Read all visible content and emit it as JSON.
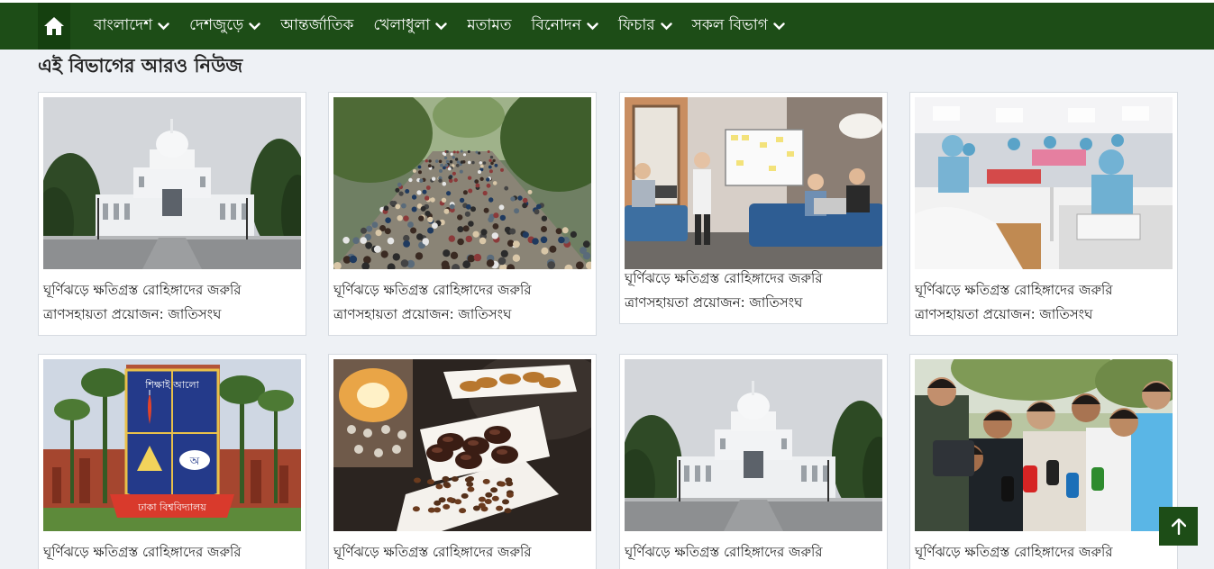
{
  "nav": {
    "items": [
      {
        "label": "বাংলাদেশ",
        "has_dropdown": true
      },
      {
        "label": "দেশজুড়ে",
        "has_dropdown": true
      },
      {
        "label": "আন্তর্জাতিক",
        "has_dropdown": false
      },
      {
        "label": "খেলাধুলা",
        "has_dropdown": true
      },
      {
        "label": "মতামত",
        "has_dropdown": false
      },
      {
        "label": "বিনোদন",
        "has_dropdown": true
      },
      {
        "label": "ফিচার",
        "has_dropdown": true
      },
      {
        "label": "সকল বিভাগ",
        "has_dropdown": true
      }
    ],
    "home_icon": "home-icon"
  },
  "section": {
    "title": "এই বিভাগের আরও নিউজ"
  },
  "cards": [
    {
      "image": "high-court-building",
      "headline": "ঘূর্ণিঝড়ে ক্ষতিগ্রস্ত রোহিঙ্গাদের জরুরি ত্রাণসহায়তা প্রয়োজন: জাতিসংঘ"
    },
    {
      "image": "street-crowd",
      "headline": "ঘূর্ণিঝড়ে ক্ষতিগ্রস্ত রোহিঙ্গাদের জরুরি ত্রাণসহায়তা প্রয়োজন: জাতিসংঘ"
    },
    {
      "image": "office-meeting",
      "headline": "ঘূর্ণিঝড়ে ক্ষতিগ্রস্ত রোহিঙ্গাদের জরুরি ত্রাণসহায়তা প্রয়োজন: জাতিসংঘ"
    },
    {
      "image": "garment-factory",
      "headline": "ঘূর্ণিঝড়ে ক্ষতিগ্রস্ত রোহিঙ্গাদের জরুরি ত্রাণসহায়তা প্রয়োজন: জাতিসংঘ"
    },
    {
      "image": "dhaka-university-logo",
      "headline": "ঘূর্ণিঝড়ে ক্ষতিগ্রস্ত রোহিঙ্গাদের জরুরি"
    },
    {
      "image": "dates-plate-lantern",
      "headline": "ঘূর্ণিঝড়ে ক্ষতিগ্রস্ত রোহিঙ্গাদের জরুরি"
    },
    {
      "image": "high-court-building",
      "headline": "ঘূর্ণিঝড়ে ক্ষতিগ্রস্ত রোহিঙ্গাদের জরুরি"
    },
    {
      "image": "press-microphones",
      "headline": "ঘূর্ণিঝড়ে ক্ষতিগ্রস্ত রোহিঙ্গাদের জরুরি"
    }
  ],
  "seal_text": {
    "top": "শিক্ষাই আলো",
    "banner": "ঢাকা বিশ্ববিদ্যালয়",
    "letter": "অ"
  },
  "scroll_top_icon": "arrow-up-icon",
  "colors": {
    "nav_bg": "#1d4d17",
    "page_bg": "#eef1f5",
    "card_border": "#d6dbe1"
  }
}
